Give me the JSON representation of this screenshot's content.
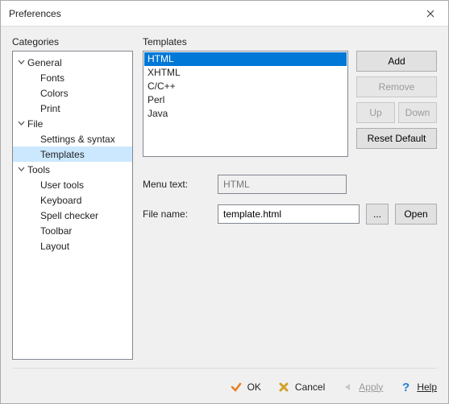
{
  "window": {
    "title": "Preferences"
  },
  "categories": {
    "label": "Categories",
    "items": [
      {
        "label": "General",
        "depth": 0,
        "expanded": true
      },
      {
        "label": "Fonts",
        "depth": 1
      },
      {
        "label": "Colors",
        "depth": 1
      },
      {
        "label": "Print",
        "depth": 1
      },
      {
        "label": "File",
        "depth": 0,
        "expanded": true
      },
      {
        "label": "Settings & syntax",
        "depth": 1
      },
      {
        "label": "Templates",
        "depth": 1,
        "selected": true
      },
      {
        "label": "Tools",
        "depth": 0,
        "expanded": true
      },
      {
        "label": "User tools",
        "depth": 1
      },
      {
        "label": "Keyboard",
        "depth": 1
      },
      {
        "label": "Spell checker",
        "depth": 1
      },
      {
        "label": "Toolbar",
        "depth": 1
      },
      {
        "label": "Layout",
        "depth": 1
      }
    ]
  },
  "templates": {
    "label": "Templates",
    "items": [
      "HTML",
      "XHTML",
      "C/C++",
      "Perl",
      "Java"
    ],
    "selected_index": 0
  },
  "buttons": {
    "add": "Add",
    "remove": "Remove",
    "up": "Up",
    "down": "Down",
    "reset_default": "Reset Default",
    "browse": "...",
    "open": "Open"
  },
  "form": {
    "menu_text_label": "Menu text:",
    "menu_text_value": "HTML",
    "file_name_label": "File name:",
    "file_name_value": "template.html"
  },
  "footer": {
    "ok": "OK",
    "cancel": "Cancel",
    "apply": "Apply",
    "help": "Help"
  }
}
